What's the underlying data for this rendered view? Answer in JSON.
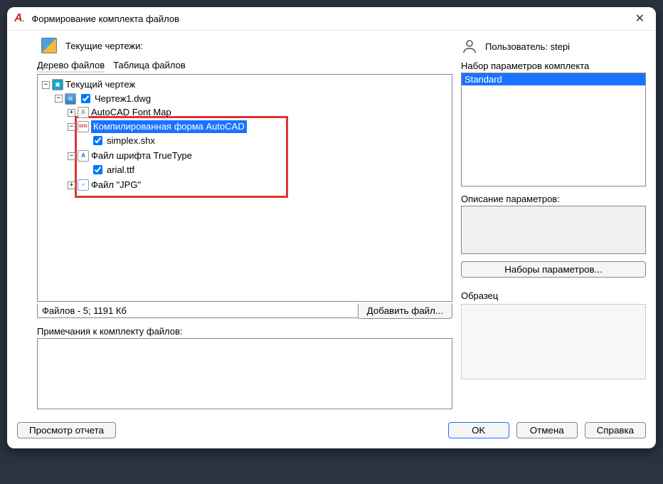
{
  "window": {
    "title": "Формирование комплекта файлов"
  },
  "header": {
    "left_label": "Текущие чертежи:",
    "user_prefix": "Пользователь:",
    "user_name": "stepi"
  },
  "tabs": {
    "tree": "Дерево файлов",
    "table": "Таблица файлов"
  },
  "tree": {
    "root": "Текущий чертеж",
    "n_dwg": "Чертеж1.dwg",
    "n_fontmap": "AutoCAD Font Map",
    "n_shx_group": "Компилированная форма AutoCAD",
    "n_shx_file": "simplex.shx",
    "n_ttf_group": "Файл шрифта TrueType",
    "n_ttf_file": "arial.ttf",
    "n_jpg": "Файл \"JPG\""
  },
  "status": "Файлов - 5; 1191 Кб",
  "buttons": {
    "add_file": "Добавить файл...",
    "param_sets": "Наборы параметров...",
    "view_report": "Просмотр отчета",
    "ok": "OK",
    "cancel": "Отмена",
    "help": "Справка"
  },
  "right": {
    "param_set_label": "Набор параметров комплекта",
    "param_item": "Standard",
    "desc_label": "Описание параметров:",
    "sample_label": "Образец"
  },
  "notes_label": "Примечания к комплекту файлов:"
}
